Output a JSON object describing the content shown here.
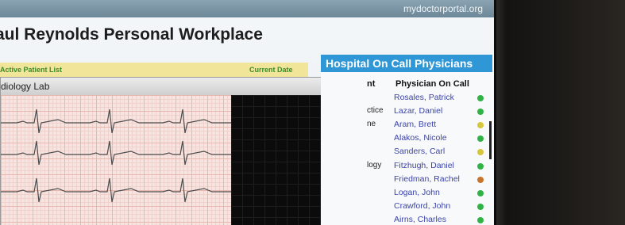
{
  "header": {
    "site": "mydoctorportal.org"
  },
  "page": {
    "title": "aul Reynolds Personal Workplace"
  },
  "patient_strip": {
    "active_label": "Active Patient List",
    "date_label": "Current Date"
  },
  "lab": {
    "title": "diology Lab"
  },
  "oncall": {
    "title": "Hospital On Call Physicians",
    "col_dept": "nt",
    "col_physician": "Physician On Call",
    "rows": [
      {
        "dept": "",
        "physician": "Rosales, Patrick",
        "status_color": "#2fb344"
      },
      {
        "dept": "ctice",
        "physician": "Lazar, Daniel",
        "status_color": "#2fb344"
      },
      {
        "dept": "ne",
        "physician": "Aram, Brett",
        "status_color": "#d7c53a"
      },
      {
        "dept": "",
        "physician": "Alakos, Nicole",
        "status_color": "#2fb344"
      },
      {
        "dept": "",
        "physician": "Sanders, Carl",
        "status_color": "#d7c53a"
      },
      {
        "dept": "logy",
        "physician": "Fitzhugh, Daniel",
        "status_color": "#2fb344"
      },
      {
        "dept": "",
        "physician": "Friedman, Rachel",
        "status_color": "#c8742a"
      },
      {
        "dept": "",
        "physician": "Logan, John",
        "status_color": "#2fb344"
      },
      {
        "dept": "",
        "physician": "Crawford, John",
        "status_color": "#2fb344"
      },
      {
        "dept": "",
        "physician": "Airns, Charles",
        "status_color": "#2fb344"
      }
    ]
  }
}
